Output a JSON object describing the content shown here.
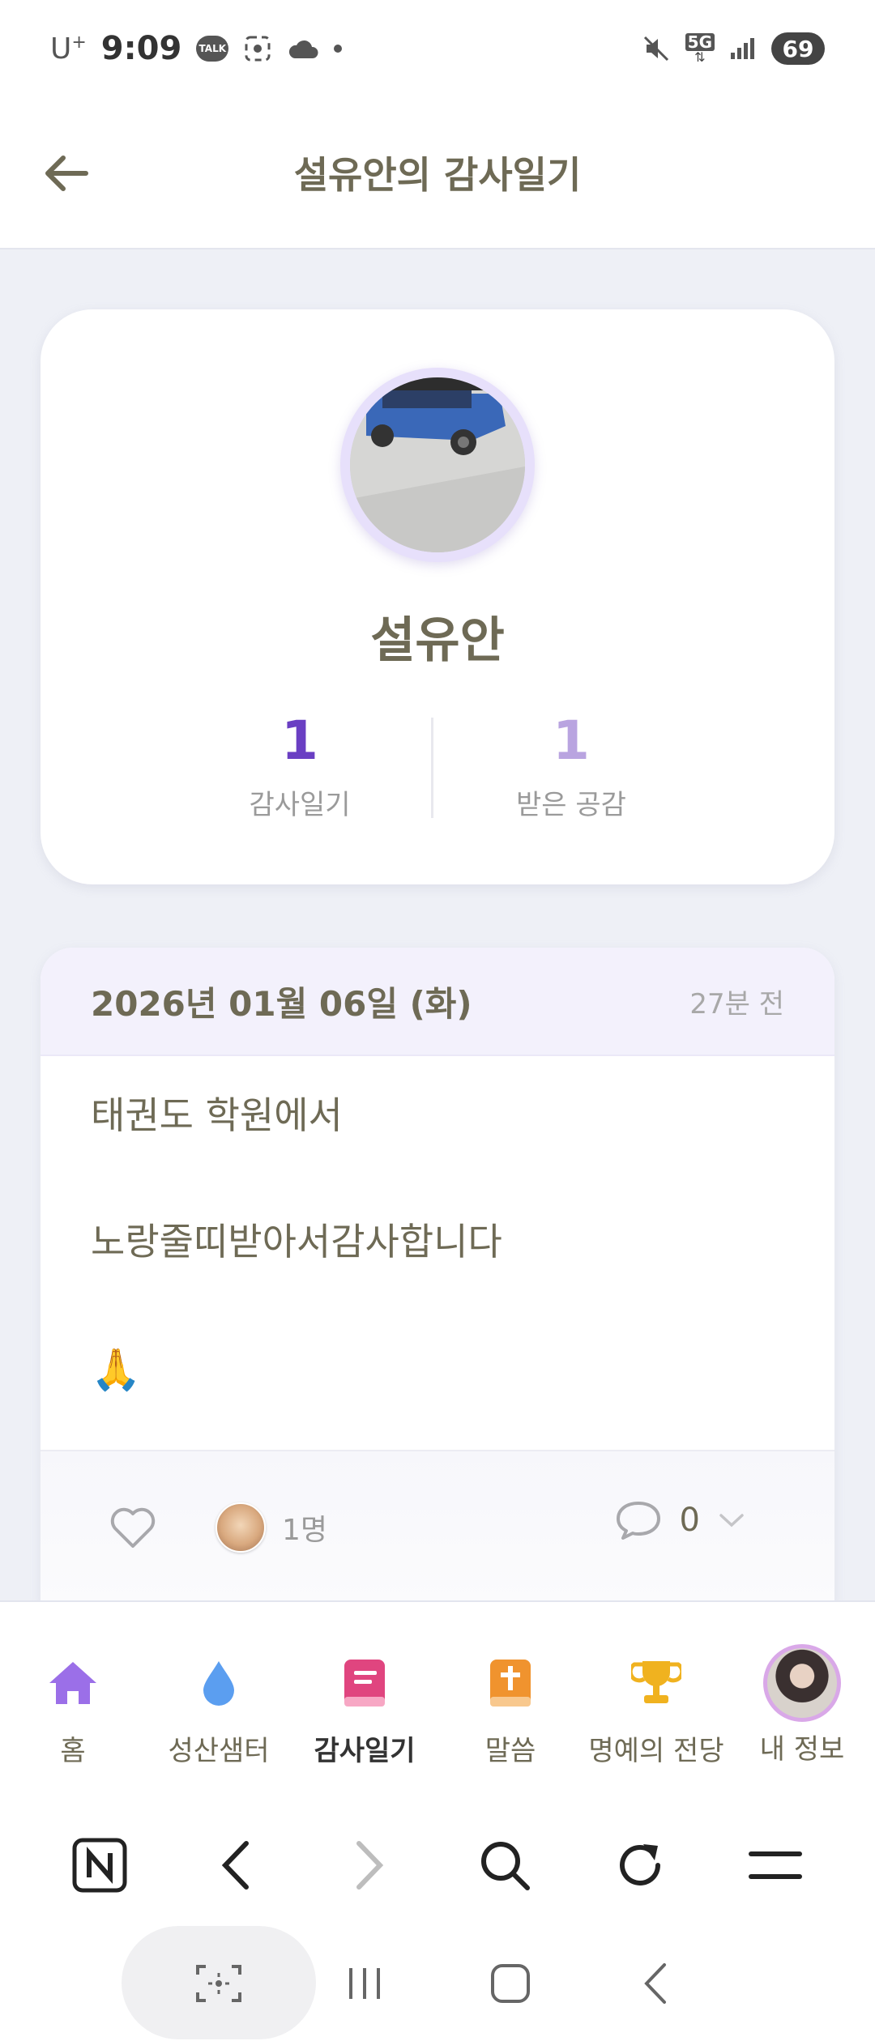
{
  "status_bar": {
    "carrier": "U",
    "carrier_sup": "+",
    "time": "9:09",
    "talk_label": "TALK",
    "network": "5G",
    "battery": "69"
  },
  "header": {
    "title": "설유안의 감사일기"
  },
  "profile": {
    "name": "설유안",
    "stats": {
      "diary_count": "1",
      "diary_label": "감사일기",
      "empathy_count": "1",
      "empathy_label": "받은 공감"
    }
  },
  "diary": {
    "date": "2026년 01월 06일 (화)",
    "relative_time": "27분 전",
    "lines": [
      "태권도 학원에서",
      "노랑줄띠받아서감사합니다",
      "🙏"
    ],
    "likers_count": "1명",
    "comment_count": "0"
  },
  "bottom_nav": {
    "items": [
      {
        "label": "홈",
        "icon": "home-icon",
        "color": "#9b6fe8"
      },
      {
        "label": "성산샘터",
        "icon": "water-drop-icon",
        "color": "#5b9ef0"
      },
      {
        "label": "감사일기",
        "icon": "diary-book-icon",
        "color": "#e0457f"
      },
      {
        "label": "말씀",
        "icon": "bible-icon",
        "color": "#f0932e"
      },
      {
        "label": "명예의 전당",
        "icon": "trophy-icon",
        "color": "#f0b21f"
      },
      {
        "label": "내 정보",
        "icon": "profile-avatar-icon"
      }
    ],
    "active_index": 2
  },
  "browser_toolbar": {
    "icons": [
      "naver-n-icon",
      "back-icon",
      "forward-icon",
      "search-icon",
      "refresh-icon",
      "menu-icon"
    ]
  }
}
